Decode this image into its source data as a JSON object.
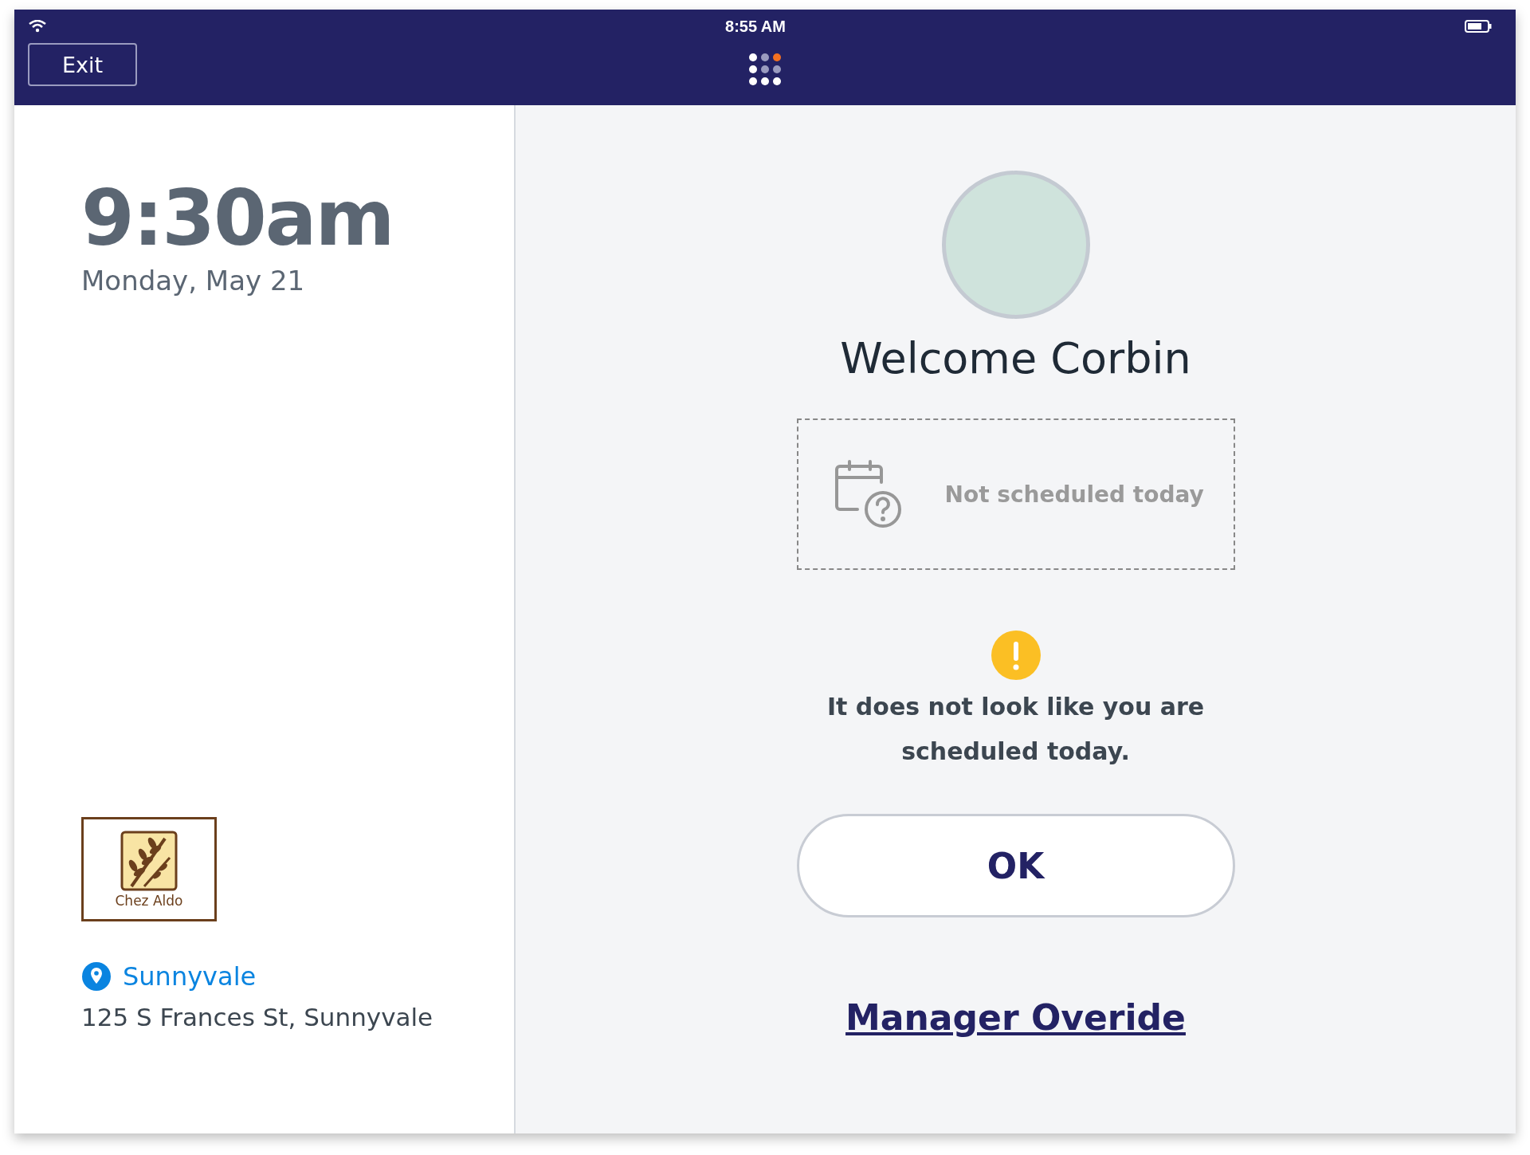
{
  "status_bar": {
    "time": "8:55 AM"
  },
  "top_bar": {
    "exit_button": "Exit"
  },
  "clock": {
    "time": "9:30am",
    "date": "Monday, May 21"
  },
  "location": {
    "logo_text": "Chez Aldo",
    "name": "Sunnyvale",
    "address": "125 S Frances St, Sunnyvale"
  },
  "welcome": {
    "greeting": "Welcome Corbin",
    "schedule_status": "Not scheduled today",
    "warning": "It does not look like you are scheduled today.",
    "ok_button": "OK",
    "manager_link": "Manager Overide"
  }
}
